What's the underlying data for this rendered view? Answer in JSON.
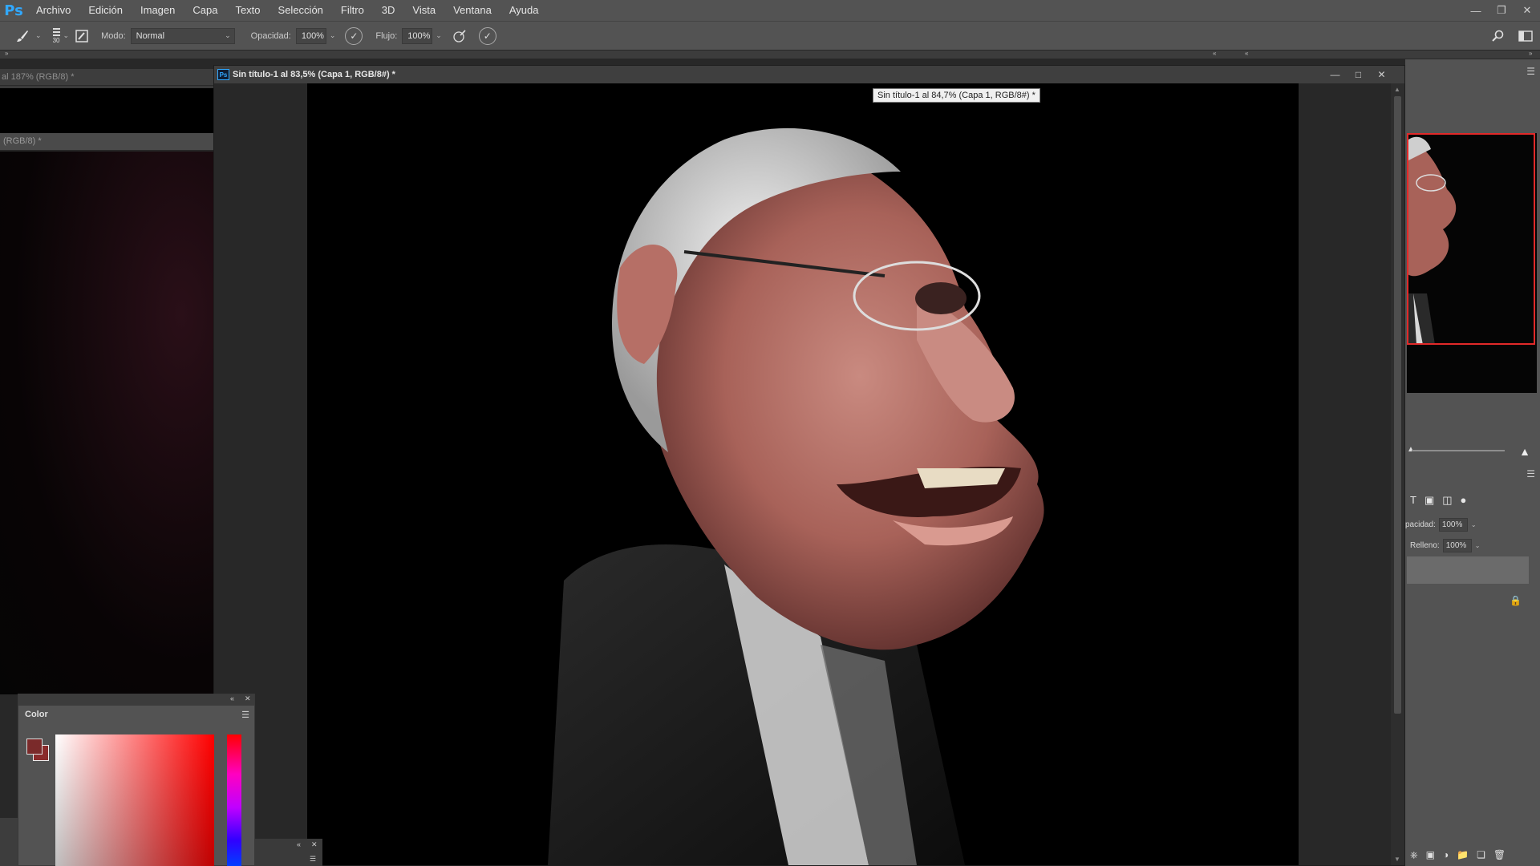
{
  "app": {
    "logo": "Ps",
    "menu": [
      "Archivo",
      "Edición",
      "Imagen",
      "Capa",
      "Texto",
      "Selección",
      "Filtro",
      "3D",
      "Vista",
      "Ventana",
      "Ayuda"
    ]
  },
  "options": {
    "brush_size": "30",
    "mode_label": "Modo:",
    "mode_value": "Normal",
    "opacity_label": "Opacidad:",
    "opacity_value": "100%",
    "flow_label": "Flujo:",
    "flow_value": "100%"
  },
  "documents": {
    "left_1_title": "al 187% (RGB/8) *",
    "left_2_title": "(RGB/8) *",
    "main_title": "Sin título-1 al 83,5% (Capa 1, RGB/8#) *",
    "tooltip": "Sin título-1 al 84,7% (Capa 1, RGB/8#) *"
  },
  "layers": {
    "opacity_label": "pacidad:",
    "opacity_value": "100%",
    "fill_label": "Relleno:",
    "fill_value": "100%"
  },
  "color_panel": {
    "tab_label": "Color",
    "foreground": "#7a2a2a",
    "background": "#8a2b2b"
  },
  "colors": {
    "menubar": "#535353",
    "accent": "#31a8ff",
    "navigator_view": "#e22929"
  },
  "icons": {
    "tool": "brush-icon",
    "toggle_panel": "brush-panel-icon",
    "airbrush": "airbrush-icon",
    "pressure": "pressure-icon",
    "search": "search-icon",
    "workspace": "workspace-icon"
  }
}
